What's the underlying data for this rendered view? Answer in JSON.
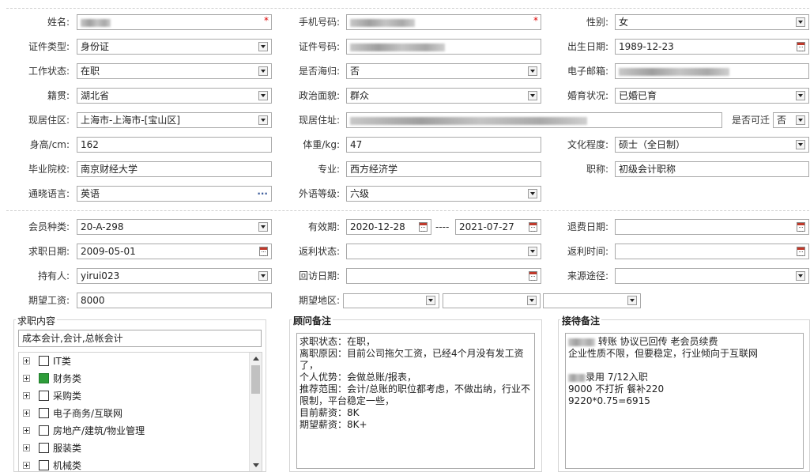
{
  "basic": {
    "name_label": "姓名:",
    "phone_label": "手机号码:",
    "gender_label": "性别:",
    "gender_value": "女",
    "idtype_label": "证件类型:",
    "idtype_value": "身份证",
    "idno_label": "证件号码:",
    "birth_label": "出生日期:",
    "birth_value": "1989-12-23",
    "workstatus_label": "工作状态:",
    "workstatus_value": "在职",
    "returnee_label": "是否海归:",
    "returnee_value": "否",
    "email_label": "电子邮箱:",
    "native_label": "籍贯:",
    "native_value": "湖北省",
    "political_label": "政治面貌:",
    "political_value": "群众",
    "marital_label": "婚育状况:",
    "marital_value": "已婚已育",
    "residence_label": "现居住区:",
    "residence_value": "上海市-上海市-[宝山区]",
    "address_label": "现居住址:",
    "relocate_label": "是否可迁",
    "relocate_value": "否",
    "height_label": "身高/cm:",
    "height_value": "162",
    "weight_label": "体重/kg:",
    "weight_value": "47",
    "education_label": "文化程度:",
    "education_value": "硕士（全日制）",
    "school_label": "毕业院校:",
    "school_value": "南京财经大学",
    "major_label": "专业:",
    "major_value": "西方经济学",
    "title_label": "职称:",
    "title_value": "初级会计职称",
    "language_label": "通晓语言:",
    "language_value": "英语",
    "langlevel_label": "外语等级:",
    "langlevel_value": "六级"
  },
  "member": {
    "type_label": "会员种类:",
    "type_value": "20-A-298",
    "valid_label": "有效期:",
    "valid_from": "2020-12-28",
    "valid_sep": "----",
    "valid_to": "2021-07-27",
    "refund_label": "退费日期:",
    "jobdate_label": "求职日期:",
    "jobdate_value": "2009-05-01",
    "rebate_status_label": "返利状态:",
    "rebate_time_label": "返利时间:",
    "holder_label": "持有人:",
    "holder_value": "yirui023",
    "revisit_label": "回访日期:",
    "source_label": "来源途径:",
    "salary_label": "期望工资:",
    "salary_value": "8000",
    "region_label": "期望地区:"
  },
  "job_content": {
    "title": "求职内容",
    "summary": "成本会计,会计,总帐会计",
    "items": [
      {
        "label": "IT类",
        "checked": false
      },
      {
        "label": "财务类",
        "checked": true
      },
      {
        "label": "采购类",
        "checked": false
      },
      {
        "label": "电子商务/互联网",
        "checked": false
      },
      {
        "label": "房地产/建筑/物业管理",
        "checked": false
      },
      {
        "label": "服装类",
        "checked": false
      },
      {
        "label": "机械类",
        "checked": false
      }
    ]
  },
  "advisor_notes": {
    "title": "顾问备注",
    "text": "求职状态：在职，\n离职原因：目前公司拖欠工资，已经4个月没有发工资了，\n个人优势：会做总账/报表，\n推荐范围：会计/总账的职位都考虑，不做出纳，行业不限制，平台稳定一些，\n目前薪资：8K\n期望薪资：8K+"
  },
  "reception_notes": {
    "title": "接待备注",
    "line1": "转账 协议已回传 老会员续费",
    "line2": "企业性质不限，但要稳定，行业倾向于互联网",
    "line3": "",
    "line4": "录用 7/12入职",
    "line5": "9000 不打折  餐补220",
    "line6": "9220*0.75=6915"
  },
  "colors": {
    "border": "#a9a9a9",
    "required": "#dd0000",
    "checked": "#2e9d3a",
    "calendar": "#c0392b"
  },
  "icons": [
    "dropdown-arrow-icon",
    "calendar-icon",
    "more-dots-icon",
    "tree-expand-icon",
    "checkbox-icon"
  ]
}
